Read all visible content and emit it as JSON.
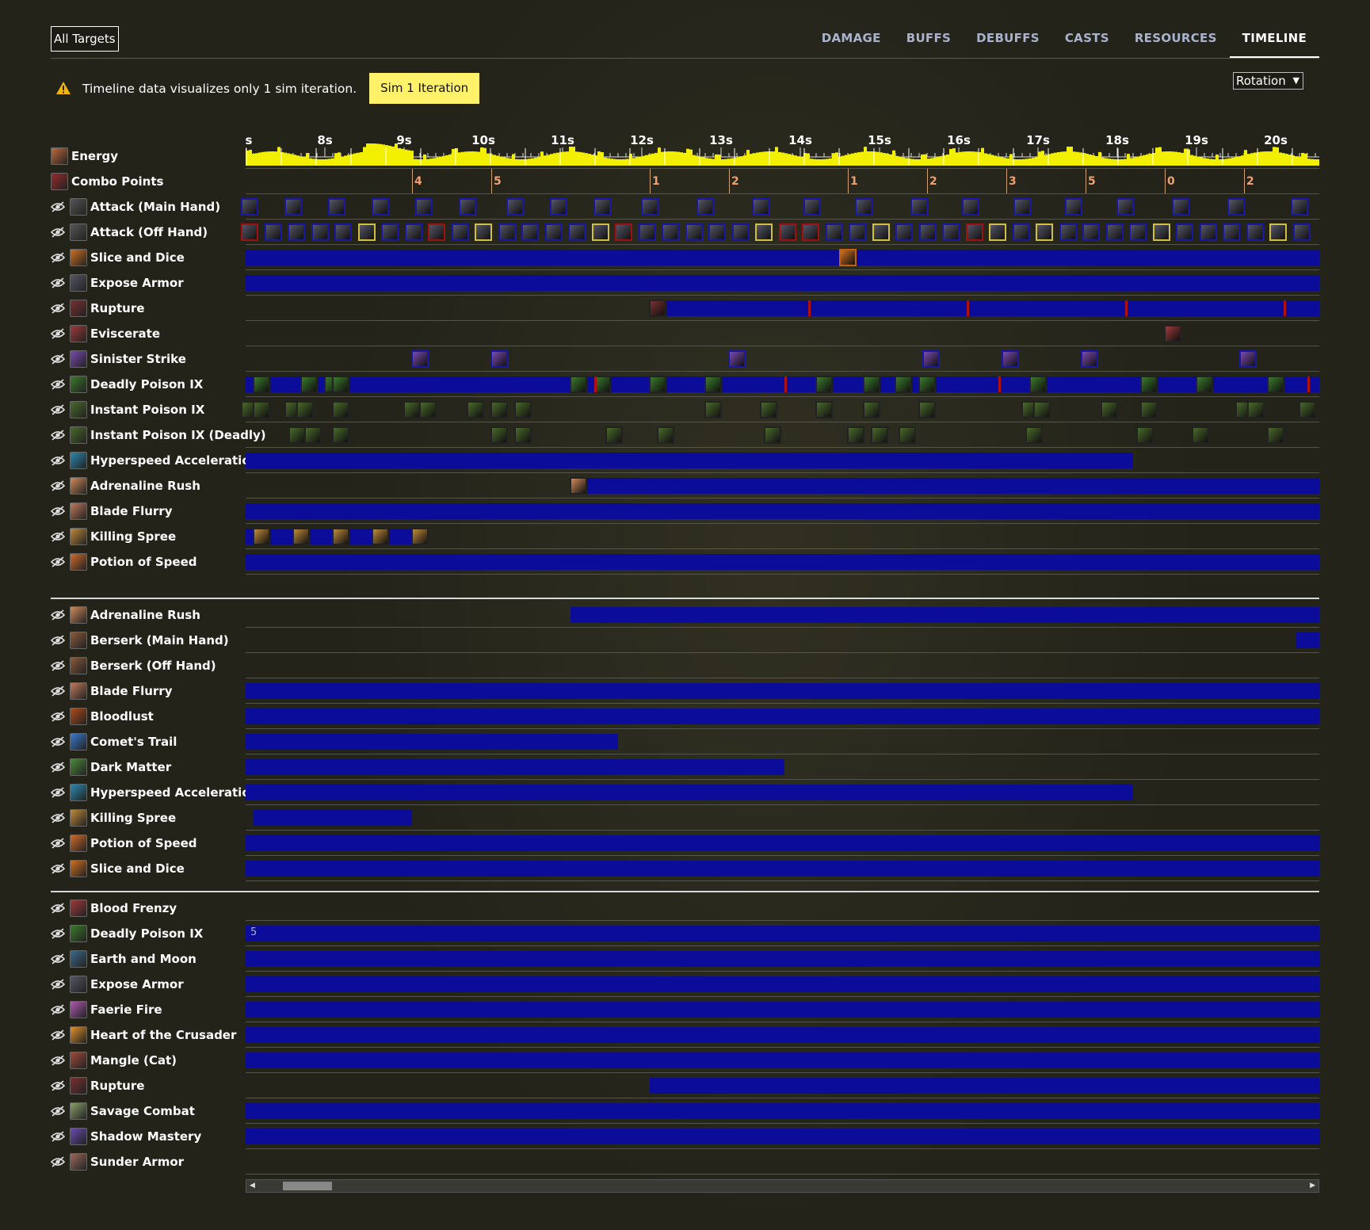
{
  "header": {
    "target_select": "All Targets",
    "tabs": [
      {
        "label": "DAMAGE"
      },
      {
        "label": "BUFFS"
      },
      {
        "label": "DEBUFFS"
      },
      {
        "label": "CASTS"
      },
      {
        "label": "RESOURCES"
      },
      {
        "label": "TIMELINE",
        "active": true
      }
    ]
  },
  "warning": {
    "text": "Timeline data visualizes only 1 sim iteration.",
    "button": "Sim 1 Iteration"
  },
  "view_select": "Rotation",
  "axis": {
    "labels": [
      "s",
      "8s",
      "9s",
      "10s",
      "11s",
      "12s",
      "13s",
      "14s",
      "15s",
      "16s",
      "17s",
      "18s",
      "19s",
      "20s"
    ]
  },
  "combo_labels": [
    "4",
    "5",
    "1",
    "2",
    "1",
    "2",
    "3",
    "5",
    "0",
    "2"
  ],
  "sections": {
    "casts": [
      {
        "label": "Energy",
        "icon": "energy-icon",
        "color": "#c06a3a"
      },
      {
        "label": "Combo Points",
        "icon": "combo-points-icon",
        "color": "#9a2a2a"
      },
      {
        "label": "Attack (Main Hand)",
        "icon": "sword-icon",
        "color": "#555"
      },
      {
        "label": "Attack (Off Hand)",
        "icon": "sword-icon",
        "color": "#555"
      },
      {
        "label": "Slice and Dice",
        "icon": "slice-and-dice-icon",
        "color": "#d07020"
      },
      {
        "label": "Expose Armor",
        "icon": "expose-armor-icon",
        "color": "#556"
      },
      {
        "label": "Rupture",
        "icon": "rupture-icon",
        "color": "#7a3030"
      },
      {
        "label": "Eviscerate",
        "icon": "eviscerate-icon",
        "color": "#a03a3a"
      },
      {
        "label": "Sinister Strike",
        "icon": "sinister-strike-icon",
        "color": "#7a4ab0"
      },
      {
        "label": "Deadly Poison IX",
        "icon": "deadly-poison-icon",
        "color": "#3a7a2a"
      },
      {
        "label": "Instant Poison IX",
        "icon": "instant-poison-icon",
        "color": "#4a6a2a"
      },
      {
        "label": "Instant Poison IX (Deadly)",
        "icon": "instant-poison-icon",
        "color": "#4a6a2a"
      },
      {
        "label": "Hyperspeed Acceleration",
        "icon": "hyperspeed-icon",
        "color": "#2a8ab0"
      },
      {
        "label": "Adrenaline Rush",
        "icon": "adrenaline-rush-icon",
        "color": "#d08a5a"
      },
      {
        "label": "Blade Flurry",
        "icon": "blade-flurry-icon",
        "color": "#c07a5a"
      },
      {
        "label": "Killing Spree",
        "icon": "killing-spree-icon",
        "color": "#c08a3a"
      },
      {
        "label": "Potion of Speed",
        "icon": "potion-icon",
        "color": "#d06a2a"
      }
    ],
    "buffs": [
      {
        "label": "Adrenaline Rush",
        "icon": "adrenaline-rush-icon",
        "color": "#d08a5a"
      },
      {
        "label": "Berserk (Main Hand)",
        "icon": "berserk-icon",
        "color": "#8a5a3a"
      },
      {
        "label": "Berserk (Off Hand)",
        "icon": "berserk-icon",
        "color": "#8a5a3a"
      },
      {
        "label": "Blade Flurry",
        "icon": "blade-flurry-icon",
        "color": "#c07a5a"
      },
      {
        "label": "Bloodlust",
        "icon": "bloodlust-icon",
        "color": "#b04a1a"
      },
      {
        "label": "Comet's Trail",
        "icon": "comets-trail-icon",
        "color": "#3a7ad0"
      },
      {
        "label": "Dark Matter",
        "icon": "dark-matter-icon",
        "color": "#4a8a3a"
      },
      {
        "label": "Hyperspeed Acceleration",
        "icon": "hyperspeed-icon",
        "color": "#2a8ab0"
      },
      {
        "label": "Killing Spree",
        "icon": "killing-spree-icon",
        "color": "#c08a3a"
      },
      {
        "label": "Potion of Speed",
        "icon": "potion-icon",
        "color": "#d06a2a"
      },
      {
        "label": "Slice and Dice",
        "icon": "slice-and-dice-icon",
        "color": "#d07020"
      }
    ],
    "debuffs": [
      {
        "label": "Blood Frenzy",
        "icon": "blood-frenzy-icon",
        "color": "#a03a3a"
      },
      {
        "label": "Deadly Poison IX",
        "icon": "deadly-poison-icon",
        "color": "#3a7a2a",
        "stack": "5"
      },
      {
        "label": "Earth and Moon",
        "icon": "earth-and-moon-icon",
        "color": "#3a6a8a"
      },
      {
        "label": "Expose Armor",
        "icon": "expose-armor-icon",
        "color": "#556"
      },
      {
        "label": "Faerie Fire",
        "icon": "faerie-fire-icon",
        "color": "#b05ab0"
      },
      {
        "label": "Heart of the Crusader",
        "icon": "heart-crusader-icon",
        "color": "#e0902a"
      },
      {
        "label": "Mangle (Cat)",
        "icon": "mangle-icon",
        "color": "#a04a3a"
      },
      {
        "label": "Rupture",
        "icon": "rupture-icon",
        "color": "#7a3030"
      },
      {
        "label": "Savage Combat",
        "icon": "savage-combat-icon",
        "color": "#8aa06a"
      },
      {
        "label": "Shadow Mastery",
        "icon": "shadow-mastery-icon",
        "color": "#6a4ab0"
      },
      {
        "label": "Sunder Armor",
        "icon": "sunder-armor-icon",
        "color": "#9a6a5a"
      }
    ]
  }
}
